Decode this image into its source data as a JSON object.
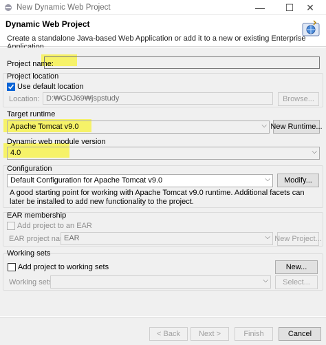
{
  "window": {
    "title": "New Dynamic Web Project",
    "controls": {
      "minimize": "—",
      "maximize": "☐",
      "close": "✕"
    }
  },
  "header": {
    "title": "Dynamic Web Project",
    "description": "Create a standalone Java-based Web Application or add it to a new or existing Enterprise Application."
  },
  "project": {
    "name_label": "Project name:",
    "name_value": ""
  },
  "location": {
    "group_label": "Project location",
    "use_default_label": "Use default location",
    "use_default_checked": true,
    "location_label": "Location:",
    "location_value": "D:₩GDJ69₩jspstudy",
    "browse_label": "Browse..."
  },
  "runtime": {
    "group_label": "Target runtime",
    "selected": "Apache Tomcat v9.0",
    "new_runtime_label": "New Runtime..."
  },
  "module": {
    "group_label": "Dynamic web module version",
    "selected": "4.0"
  },
  "configuration": {
    "group_label": "Configuration",
    "selected": "Default Configuration for Apache Tomcat v9.0",
    "modify_label": "Modify...",
    "description": "A good starting point for working with Apache Tomcat v9.0 runtime. Additional facets can later be installed to add new functionality to the project."
  },
  "ear": {
    "group_label": "EAR membership",
    "add_label": "Add project to an EAR",
    "project_name_label": "EAR project name:",
    "project_name_value": "EAR",
    "new_project_label": "New Project..."
  },
  "working_sets": {
    "group_label": "Working sets",
    "add_label": "Add project to working sets",
    "new_label": "New...",
    "sets_label": "Working sets:",
    "sets_value": "",
    "select_label": "Select..."
  },
  "footer": {
    "back_label": "< Back",
    "next_label": "Next >",
    "finish_label": "Finish",
    "cancel_label": "Cancel"
  },
  "colors": {
    "accent": "#0a64d6",
    "highlight": "#f7f250",
    "dialog_bg": "#f0f0f0"
  }
}
